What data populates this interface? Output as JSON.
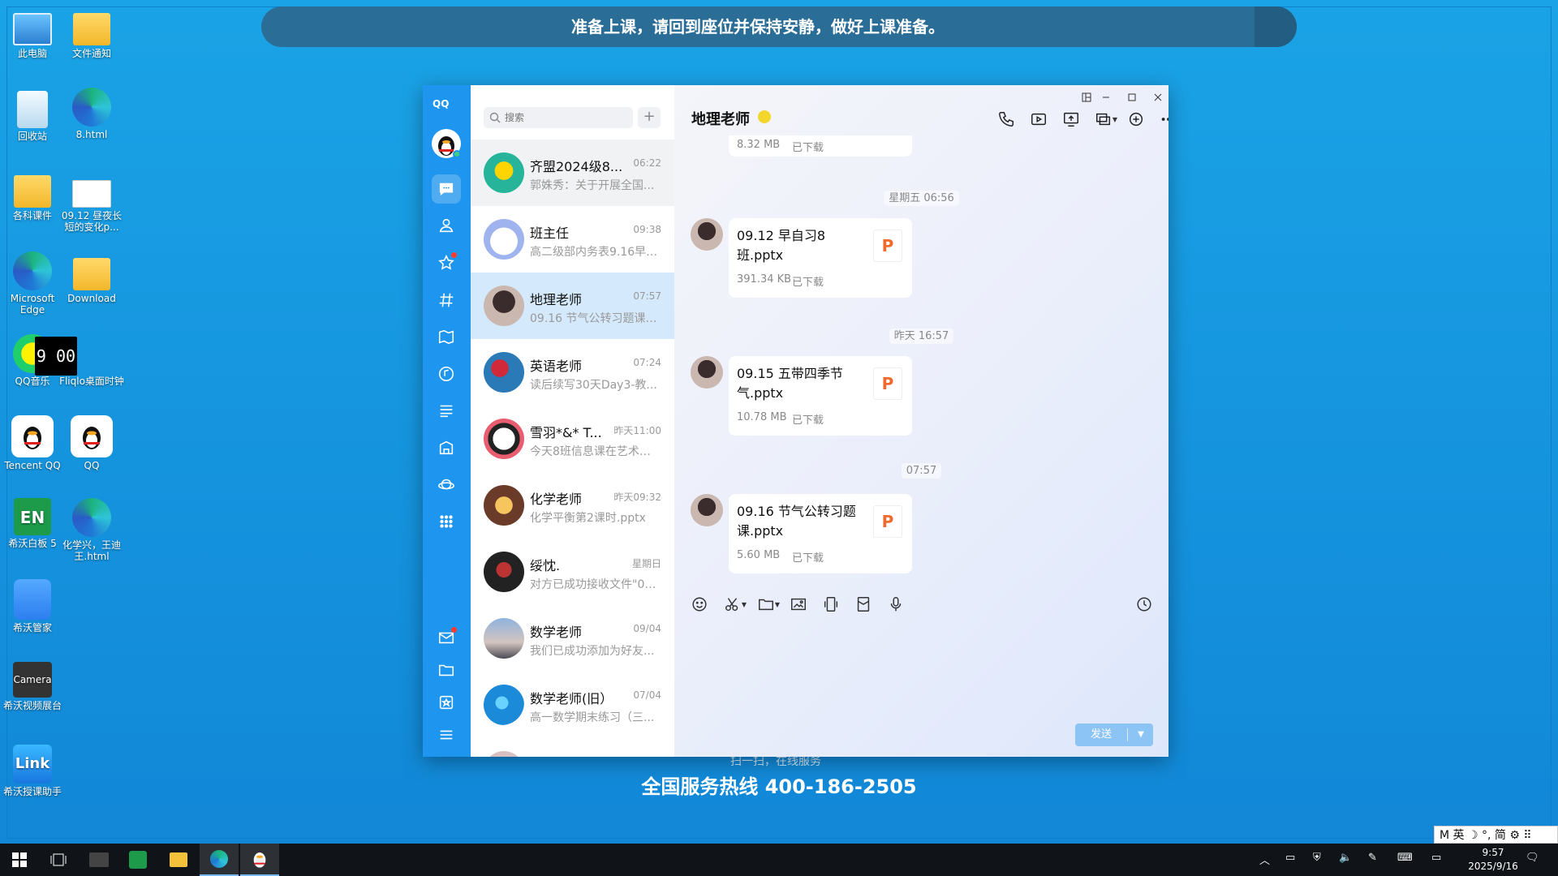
{
  "banner": {
    "text": "准备上课，请回到座位并保持安静，做好上课准备。"
  },
  "desktop": {
    "icons": [
      {
        "label": "此电脑",
        "icon": "computer-icon"
      },
      {
        "label": "文件通知",
        "icon": "folder-warning-icon"
      },
      {
        "label": "回收站",
        "icon": "recycle-bin-icon"
      },
      {
        "label": "8.html",
        "icon": "edge-icon"
      },
      {
        "label": "各科课件",
        "icon": "folder-icon"
      },
      {
        "label": "09.12 昼夜长短的变化p...",
        "icon": "ppt-file-icon"
      },
      {
        "label": "Microsoft Edge",
        "icon": "edge-icon"
      },
      {
        "label": "Download",
        "icon": "folder-icon"
      },
      {
        "label": "QQ音乐",
        "icon": "qq-music-icon"
      },
      {
        "label": "Fliqlo桌面时钟",
        "icon": "clock-icon"
      },
      {
        "label": "Tencent QQ",
        "icon": "qq-icon"
      },
      {
        "label": "QQ",
        "icon": "qq-icon"
      },
      {
        "label": "希沃白板 5",
        "icon": "seewo-board-icon"
      },
      {
        "label": "化学兴，王迪王.html",
        "icon": "edge-icon"
      },
      {
        "label": "希沃管家",
        "icon": "shield-icon"
      },
      {
        "label": "希沃视频展台",
        "icon": "camera-icon"
      },
      {
        "label": "希沃授课助手",
        "icon": "link-icon"
      }
    ],
    "clock_text": "9 00",
    "en_text": "EN",
    "camera_text": "Camera",
    "link_text": "Link"
  },
  "qq": {
    "logo": "QQ",
    "search": {
      "placeholder": "搜索"
    },
    "add": "+",
    "conversations": [
      {
        "name": "齐盟2024级8...",
        "time": "06:22",
        "preview": "郭姝秀：关于开展全国..."
      },
      {
        "name": "班主任",
        "time": "09:38",
        "preview": "高二级部内务表9.16早(..."
      },
      {
        "name": "地理老师",
        "time": "07:57",
        "preview": "09.16 节气公转习题课...."
      },
      {
        "name": "英语老师",
        "time": "07:24",
        "preview": "读后续写30天Day3-教..."
      },
      {
        "name": "雪羽*&* T...",
        "time": "昨天11:00",
        "preview": "今天8班信息课在艺术楼..."
      },
      {
        "name": "化学老师",
        "time": "昨天09:32",
        "preview": "化学平衡第2课时.pptx"
      },
      {
        "name": "绥忱.",
        "time": "星期日",
        "preview": "对方已成功接收文件\"09..."
      },
      {
        "name": "数学老师",
        "time": "09/04",
        "preview": "我们已成功添加为好友..."
      },
      {
        "name": "数学老师(旧）",
        "time": "07/04",
        "preview": "高一数学期末练习（三..."
      }
    ],
    "chat": {
      "title": "地理老师",
      "partial_file": {
        "size": "8.32 MB",
        "status": "已下载"
      },
      "messages": [
        {
          "time": "星期五 06:56",
          "file": "09.12 早自习8班.pptx",
          "size": "391.34 KB",
          "status": "已下载"
        },
        {
          "time": "昨天 16:57",
          "file": "09.15 五带四季节气.pptx",
          "size": "10.78 MB",
          "status": "已下载"
        },
        {
          "time": "07:57",
          "file": "09.16 节气公转习题课.pptx",
          "size": "5.60 MB",
          "status": "已下载"
        }
      ],
      "file_icon_letter": "P",
      "send_label": "发送"
    }
  },
  "background": {
    "scan_text": "扫一扫，在线服务",
    "hotline": "全国服务热线 400-186-2505"
  },
  "ime": {
    "text": "M 英 ☽ °, 简 ⚙ ⠿"
  },
  "taskbar": {
    "time": "9:57",
    "date": "2025/9/16"
  },
  "colors": {
    "accent": "#1e95ee",
    "desktop_bg": "#1186d6",
    "selected_row": "#d4e9fb",
    "ppt_orange": "#f06a2e"
  }
}
